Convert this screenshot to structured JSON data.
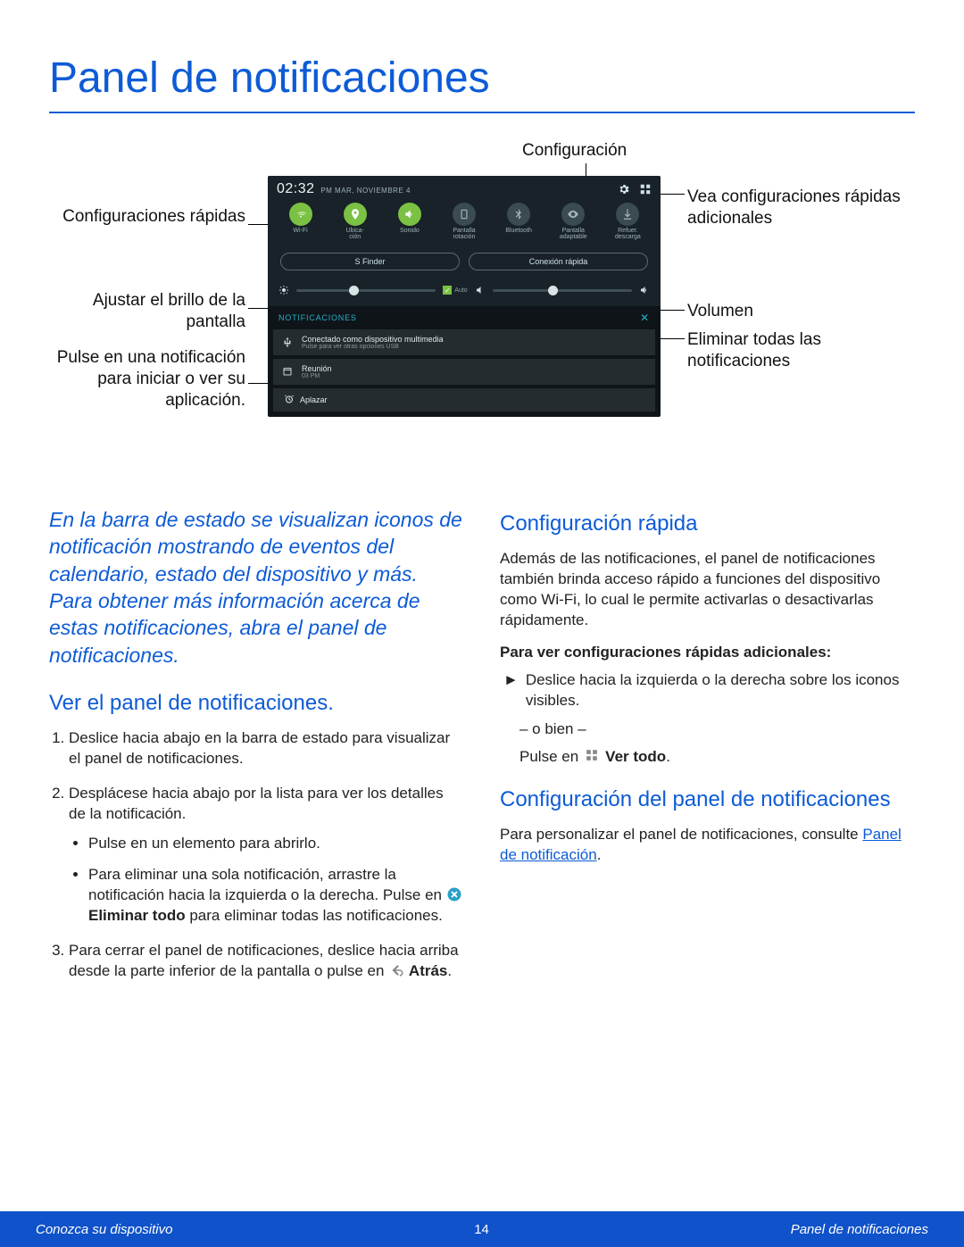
{
  "page_title": "Panel de notificaciones",
  "diagram": {
    "time": "02:32",
    "date_line": "PM  MAR, NOVIEMBRE 4",
    "settings_label": "Configuración",
    "view_more_label": "Vea configuraciones rápidas adicionales",
    "quick_settings_label": "Configuraciones rápidas",
    "brightness_label": "Ajustar el brillo de la pantalla",
    "volume_label": "Volumen",
    "clear_label": "Eliminar todas las notificaciones",
    "tap_notif_label": "Pulse en una notificación para iniciar o ver su aplicación.",
    "quick_settings": [
      {
        "label": "Wi-Fi",
        "on": true,
        "icon": "wifi"
      },
      {
        "label": "Ubica-\nción",
        "on": true,
        "icon": "location"
      },
      {
        "label": "Sonido",
        "on": true,
        "icon": "sound"
      },
      {
        "label": "Pantalla\nrotación",
        "on": false,
        "icon": "rotate"
      },
      {
        "label": "Bluetooth",
        "on": false,
        "icon": "bluetooth"
      },
      {
        "label": "Pantalla\nadaptable",
        "on": false,
        "icon": "eye"
      },
      {
        "label": "Refuer.\ndescarga",
        "on": false,
        "icon": "boost"
      }
    ],
    "btn_sfinder": "S Finder",
    "btn_quickconnect": "Conexión rápida",
    "auto_label": "Auto",
    "notif_header": "NOTIFICACIONES",
    "notif1_title": "Conectado como dispositivo multimedia",
    "notif1_sub": "Pulse para ver otras opciones USB",
    "notif2_title": "Reunión",
    "notif2_sub": "03 PM",
    "aplazar": "Aplazar"
  },
  "leftcol": {
    "intro": "En la barra de estado se visualizan iconos de notificación mostrando de eventos del calendario, estado del dispositivo y más. Para obtener más información acerca de estas notificaciones, abra el panel de notificaciones.",
    "h_view": "Ver el panel de notificaciones.",
    "step1": "Deslice hacia abajo en la barra de estado para visualizar el panel de notificaciones.",
    "step2": "Desplácese hacia abajo por la lista para ver los detalles de la notificación.",
    "b1": "Pulse en un elemento para abrirlo.",
    "b2a": "Para eliminar una sola notificación, arrastre la notificación hacia la izquierda o la derecha. Pulse en ",
    "b2b": " Eliminar todo",
    "b2c": " para eliminar todas las notificaciones.",
    "step3a": "Para cerrar el panel de notificaciones, deslice hacia arriba desde la parte inferior de la pantalla o pulse en ",
    "step3b": " Atrás",
    "step3c": "."
  },
  "rightcol": {
    "h_quick": "Configuración rápida",
    "p_quick": "Además de las notificaciones, el panel de notificaciones también brinda acceso rápido a funciones del dispositivo como Wi-Fi, lo cual le permite activarlas o desactivarlas rápidamente.",
    "subhead": "Para ver configuraciones rápidas adicionales:",
    "a1": "Deslice hacia la izquierda o la derecha sobre los iconos visibles.",
    "or": "– o bien –",
    "a2a": "Pulse en ",
    "a2b": " Ver todo",
    "a2c": ".",
    "h_conf": "Configuración del panel de notificaciones",
    "p_conf_a": "Para personalizar el panel de notificaciones, consulte ",
    "p_conf_link": "Panel de notificación",
    "p_conf_c": "."
  },
  "footer": {
    "left": "Conozca su dispositivo",
    "page": "14",
    "right": "Panel de notificaciones"
  }
}
